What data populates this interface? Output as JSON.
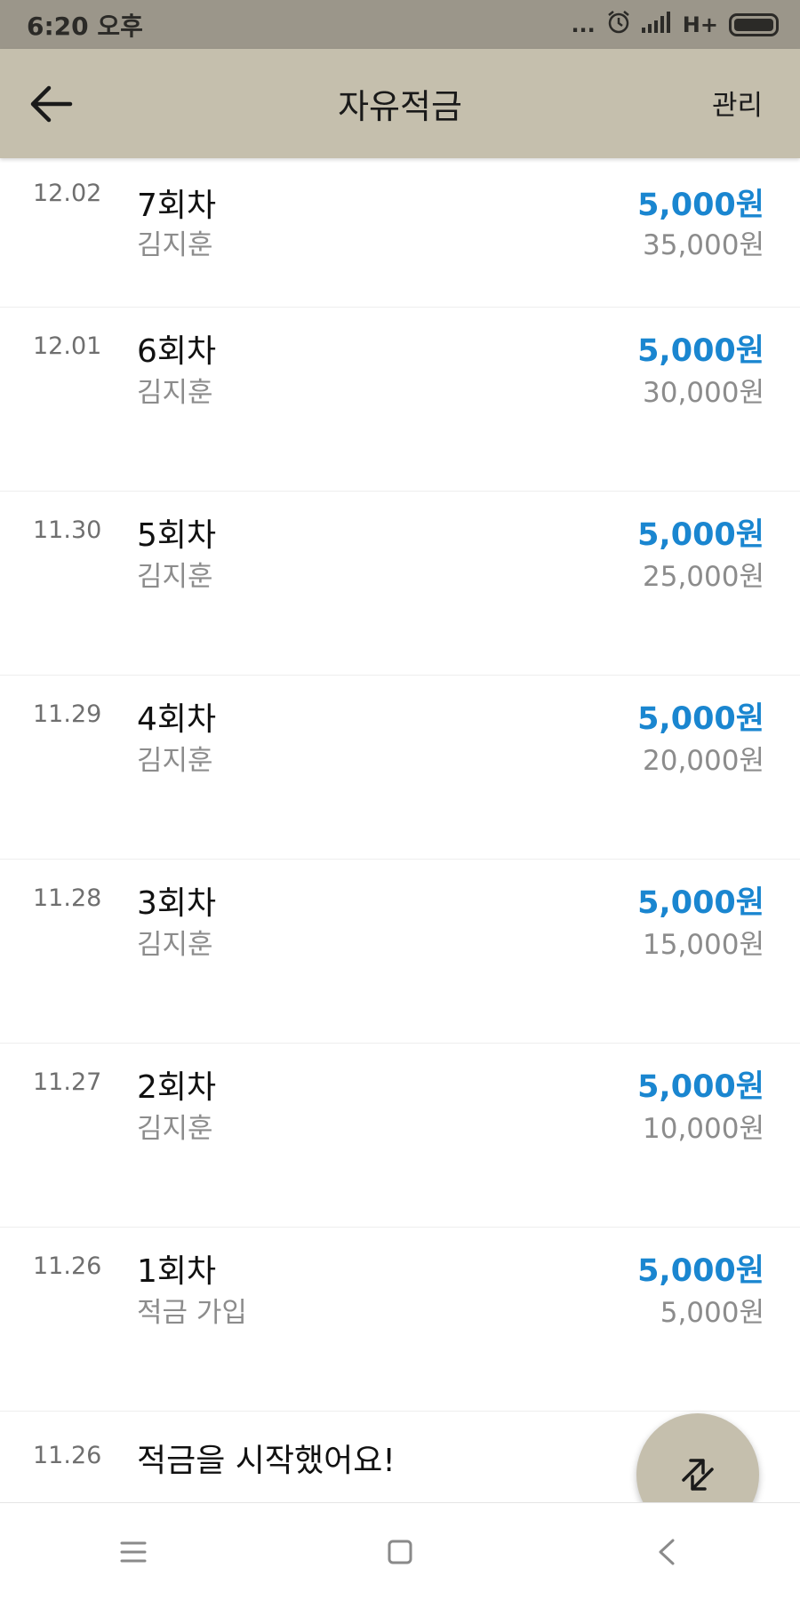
{
  "status_bar": {
    "time": "6:20 오후",
    "network": "H+",
    "dots": "..."
  },
  "app_bar": {
    "title": "자유적금",
    "manage_label": "관리"
  },
  "transactions": [
    {
      "date": "12.02",
      "title": "7회차",
      "subtitle": "김지훈",
      "amount": "5,000원",
      "total": "35,000원"
    },
    {
      "date": "12.01",
      "title": "6회차",
      "subtitle": "김지훈",
      "amount": "5,000원",
      "total": "30,000원"
    },
    {
      "date": "11.30",
      "title": "5회차",
      "subtitle": "김지훈",
      "amount": "5,000원",
      "total": "25,000원"
    },
    {
      "date": "11.29",
      "title": "4회차",
      "subtitle": "김지훈",
      "amount": "5,000원",
      "total": "20,000원"
    },
    {
      "date": "11.28",
      "title": "3회차",
      "subtitle": "김지훈",
      "amount": "5,000원",
      "total": "15,000원"
    },
    {
      "date": "11.27",
      "title": "2회차",
      "subtitle": "김지훈",
      "amount": "5,000원",
      "total": "10,000원"
    },
    {
      "date": "11.26",
      "title": "1회차",
      "subtitle": "적금 가입",
      "amount": "5,000원",
      "total": "5,000원"
    }
  ],
  "start_event": {
    "date": "11.26",
    "title": "적금을 시작했어요!"
  },
  "colors": {
    "app_bar": "#c5bfad",
    "status_bar": "#9b968a",
    "amount_blue": "#1a86d0"
  },
  "icons": {
    "back": "arrow-left-icon",
    "fab": "swap-arrows-icon",
    "nav_menu": "menu-icon",
    "nav_home": "square-home-icon",
    "nav_back": "chevron-left-icon"
  }
}
